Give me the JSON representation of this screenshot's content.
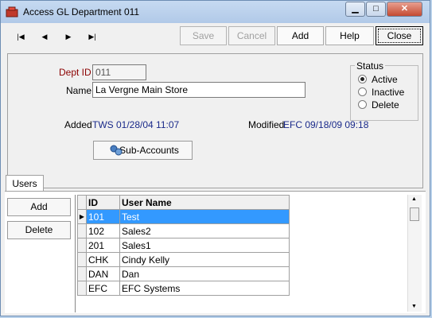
{
  "window": {
    "title": "Access GL Department 011",
    "controls": {
      "minimize": "▁",
      "maximize": "□",
      "close": "✕"
    }
  },
  "toolbar": {
    "nav": {
      "first": "|◀",
      "prev": "◀",
      "next": "▶",
      "last": "▶|"
    },
    "save_label": "Save",
    "cancel_label": "Cancel",
    "add_label": "Add",
    "help_label": "Help",
    "close_label": "Close"
  },
  "form": {
    "dept_id_label": "Dept ID",
    "dept_id_value": "011",
    "name_label": "Name",
    "name_value": "La Vergne Main Store",
    "status": {
      "legend": "Status",
      "options": [
        "Active",
        "Inactive",
        "Delete"
      ],
      "selected": "Active"
    },
    "added_label": "Added",
    "added_value": "TWS 01/28/04 11:07",
    "modified_label": "Modified",
    "modified_value": "EFC 09/18/09 09:18",
    "sub_accounts_label": "Sub-Accounts"
  },
  "tabs": {
    "users": "Users"
  },
  "users": {
    "add_label": "Add",
    "delete_label": "Delete",
    "columns": [
      "ID",
      "User Name"
    ],
    "rows": [
      [
        "101",
        "Test"
      ],
      [
        "102",
        "Sales2"
      ],
      [
        "201",
        "Sales1"
      ],
      [
        "CHK",
        "Cindy Kelly"
      ],
      [
        "DAN",
        "Dan"
      ],
      [
        "EFC",
        "EFC Systems"
      ]
    ]
  },
  "colors": {
    "selection": "#3399ff",
    "titlebar": "#c6daf1",
    "label_red": "#8b0000",
    "value_blue": "#1a2a8a"
  }
}
